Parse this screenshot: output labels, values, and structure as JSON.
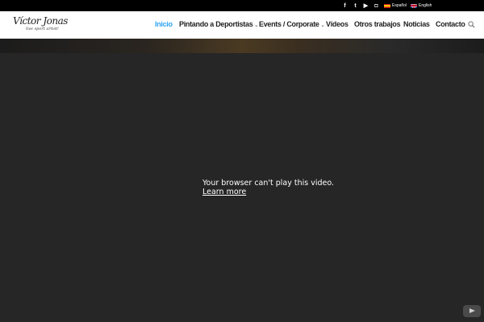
{
  "topbar": {
    "social": [
      {
        "icon": "facebook-icon",
        "glyph": "f"
      },
      {
        "icon": "twitter-icon",
        "glyph": "t"
      },
      {
        "icon": "youtube-icon",
        "glyph": "▶"
      },
      {
        "icon": "instagram-icon",
        "glyph": "◘"
      }
    ],
    "languages": [
      {
        "label": "Español",
        "flag": "spain-flag-icon"
      },
      {
        "label": "English",
        "flag": "uk-flag-icon"
      }
    ]
  },
  "header": {
    "logo": {
      "name": "Víctor Jonas",
      "tagline": "live sport artist!"
    },
    "nav": [
      {
        "label": "Inicio",
        "active": true,
        "dropdown": false
      },
      {
        "label": "Pintando a Deportistas",
        "active": false,
        "dropdown": true
      },
      {
        "label": "Events / Corporate",
        "active": false,
        "dropdown": true
      },
      {
        "label": "Vídeos",
        "active": false,
        "dropdown": false
      },
      {
        "label": "Otros trabajos",
        "active": false,
        "dropdown": false
      },
      {
        "label": "Noticias",
        "active": false,
        "dropdown": false
      },
      {
        "label": "Contacto",
        "active": false,
        "dropdown": false
      }
    ],
    "accent_color": "#2ea3f2"
  },
  "video": {
    "message": "Your browser can't play this video.",
    "link": "Learn more",
    "player_icon": "youtube-logo-icon"
  }
}
